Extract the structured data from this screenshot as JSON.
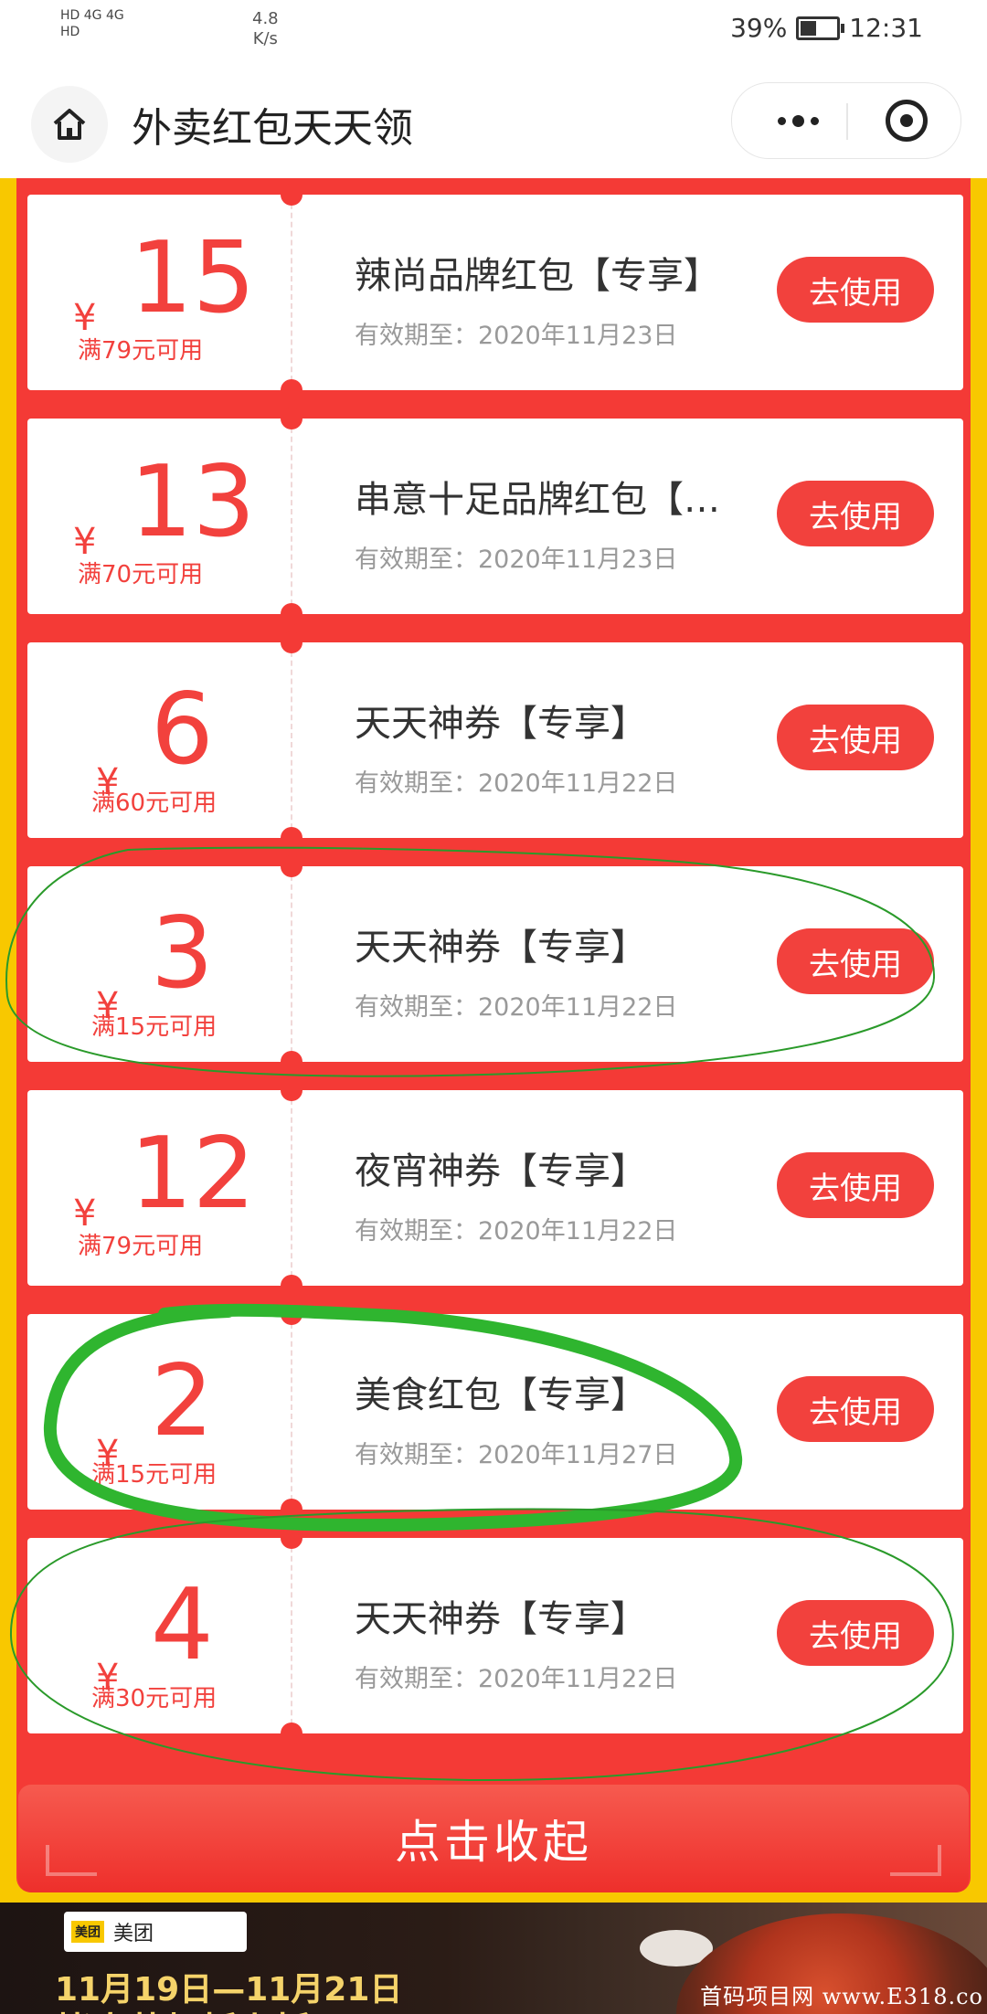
{
  "status_bar": {
    "network_left_top": "HD 4G 4G",
    "network_left_bottom": "HD",
    "speed_value": "4.8",
    "speed_unit": "K/s",
    "battery": "39%",
    "time": "12:31"
  },
  "nav": {
    "title": "外卖红包天天领"
  },
  "coupons": [
    {
      "currency": "¥",
      "amount": "15",
      "condition": "满79元可用",
      "name": "辣尚品牌红包【专享】",
      "expiry": "有效期至：2020年11月23日",
      "button": "去使用"
    },
    {
      "currency": "¥",
      "amount": "13",
      "condition": "满70元可用",
      "name": "串意十足品牌红包【专…",
      "expiry": "有效期至：2020年11月23日",
      "button": "去使用"
    },
    {
      "currency": "¥",
      "amount": "6",
      "condition": "满60元可用",
      "name": "天天神券【专享】",
      "expiry": "有效期至：2020年11月22日",
      "button": "去使用"
    },
    {
      "currency": "¥",
      "amount": "3",
      "condition": "满15元可用",
      "name": "天天神券【专享】",
      "expiry": "有效期至：2020年11月22日",
      "button": "去使用"
    },
    {
      "currency": "¥",
      "amount": "12",
      "condition": "满79元可用",
      "name": "夜宵神券【专享】",
      "expiry": "有效期至：2020年11月22日",
      "button": "去使用"
    },
    {
      "currency": "¥",
      "amount": "2",
      "condition": "满15元可用",
      "name": "美食红包【专享】",
      "expiry": "有效期至：2020年11月27日",
      "button": "去使用"
    },
    {
      "currency": "¥",
      "amount": "4",
      "condition": "满30元可用",
      "name": "天天神券【专享】",
      "expiry": "有效期至：2020年11月22日",
      "button": "去使用"
    }
  ],
  "collapse_label": "点击收起",
  "banner": {
    "brand": "美团",
    "brand_badge": "美团",
    "dates": "11月19日—11月21日",
    "headline": "烤肉萝虾折上折",
    "watermark": "首码项目网 www.E318.co"
  },
  "colors": {
    "accent_red": "#f43a36",
    "button_red": "#f2413d",
    "frame_yellow": "#f8c800",
    "annotation_green": "#2fb52f"
  }
}
